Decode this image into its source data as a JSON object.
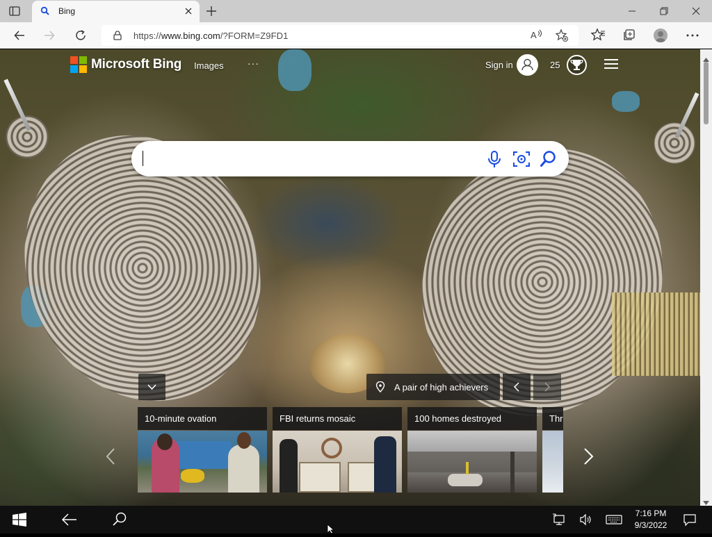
{
  "browser": {
    "tab": {
      "title": "Bing"
    },
    "address": {
      "scheme": "https://",
      "domain": "www.bing.com",
      "path": "/?FORM=Z9FD1"
    },
    "read_aloud_glyph": "À"
  },
  "bing": {
    "brand": "Microsoft Bing",
    "nav": {
      "images": "Images",
      "more": "···"
    },
    "signin": "Sign in",
    "rewards_points": "25",
    "search": {
      "value": "",
      "placeholder": ""
    },
    "image_caption": "A pair of high achievers",
    "news": [
      {
        "title": "10-minute ovation"
      },
      {
        "title": "FBI returns mosaic"
      },
      {
        "title": "100 homes destroyed"
      },
      {
        "title": "Thr"
      }
    ]
  },
  "taskbar": {
    "time": "7:16 PM",
    "date": "9/3/2022"
  },
  "colors": {
    "ms_red": "#f25022",
    "ms_green": "#7fba00",
    "ms_blue": "#00a4ef",
    "ms_yellow": "#ffb900",
    "bing_icon_blue": "#174ae4"
  }
}
